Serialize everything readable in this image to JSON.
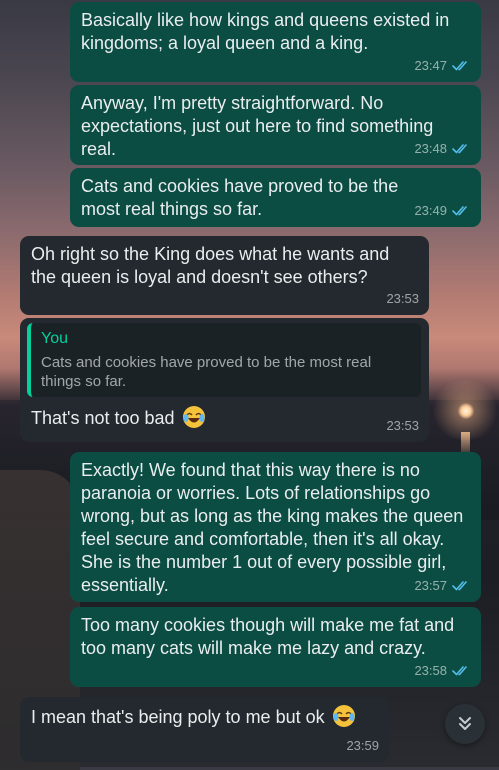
{
  "colors": {
    "outgoing_bubble": "#0c4d43",
    "incoming_bubble": "#23292e",
    "read_ticks": "#53bdeb",
    "quote_accent": "#06cf9c"
  },
  "messages": [
    {
      "direction": "outgoing",
      "text": "Basically like how kings and queens existed in kingdoms; a loyal queen and a king.",
      "time": "23:47",
      "status": "read"
    },
    {
      "direction": "outgoing",
      "text": "Anyway, I'm pretty straightforward. No expectations, just out here to find something real.",
      "time": "23:48",
      "status": "read"
    },
    {
      "direction": "outgoing",
      "text": "Cats and cookies have proved to be the most real things so far.",
      "time": "23:49",
      "status": "read"
    },
    {
      "direction": "incoming",
      "text": "Oh right so the King does what he wants and the queen is loyal and doesn't see others?",
      "time": "23:53"
    },
    {
      "direction": "incoming",
      "quote": {
        "author": "You",
        "text": "Cats and cookies have proved to be the most real things so far."
      },
      "text": "That's not too bad",
      "emoji": "face-with-tears-of-joy",
      "time": "23:53"
    },
    {
      "direction": "outgoing",
      "text": "Exactly! We found that this way there is no paranoia or worries. Lots of relationships go wrong, but as long as the king makes the queen feel secure and comfortable, then it's all okay. She is the number 1 out of every possible girl, essentially.",
      "time": "23:57",
      "status": "read"
    },
    {
      "direction": "outgoing",
      "text": "Too many cookies though will make me fat and too many cats will make me lazy and crazy.",
      "time": "23:58",
      "status": "read"
    },
    {
      "direction": "incoming",
      "text": "I mean that's being poly to me but ok",
      "emoji": "face-with-tears-of-joy",
      "time": "23:59"
    }
  ],
  "scroll_button": {
    "icon": "double-chevron-down-icon"
  }
}
